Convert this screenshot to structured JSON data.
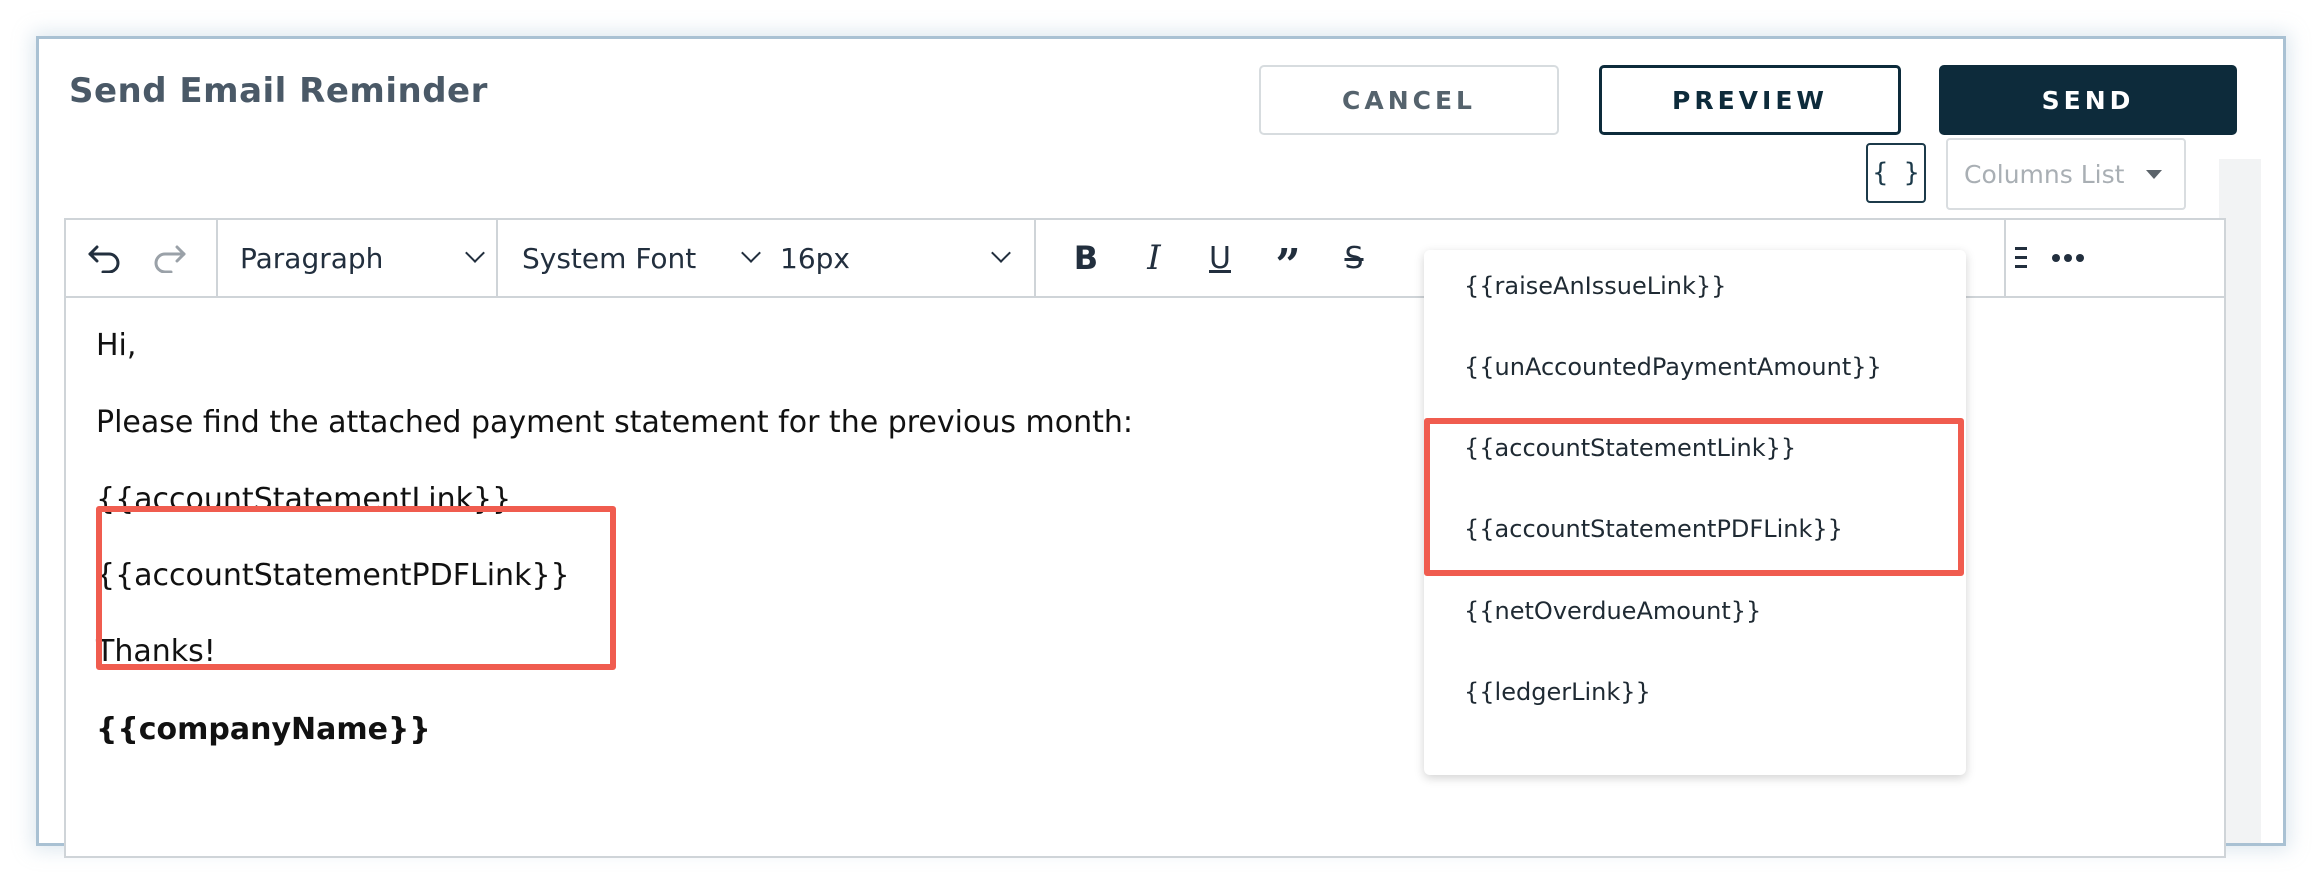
{
  "dialog": {
    "title": "Send Email Reminder",
    "cancel_label": "CANCEL",
    "preview_label": "PREVIEW",
    "send_label": "SEND"
  },
  "variables_button": {
    "label": "{ }"
  },
  "columns_list": {
    "placeholder": "Columns List"
  },
  "toolbar": {
    "block_format": "Paragraph",
    "font_family": "System Font",
    "font_size": "16px"
  },
  "editor": {
    "paragraphs": [
      {
        "text": "Hi,",
        "bold": false
      },
      {
        "text": "Please find the attached payment statement for the previous month:",
        "bold": false
      },
      {
        "text": "{{accountStatementLink}}",
        "bold": false
      },
      {
        "text": "{{accountStatementPDFLink}}",
        "bold": false
      },
      {
        "text": "Thanks!",
        "bold": false
      },
      {
        "text": "{{companyName}}",
        "bold": true
      }
    ]
  },
  "variables_dropdown": {
    "items": [
      "{{raiseAnIssueLink}}",
      "{{unAccountedPaymentAmount}}",
      "{{accountStatementLink}}",
      "{{accountStatementPDFLink}}",
      "{{netOverdueAmount}}",
      "{{ledgerLink}}"
    ]
  },
  "colors": {
    "primary": "#0d2b3b",
    "highlight": "#f05c4f",
    "frame_border": "#a9c1d3",
    "title": "#4a5967"
  }
}
